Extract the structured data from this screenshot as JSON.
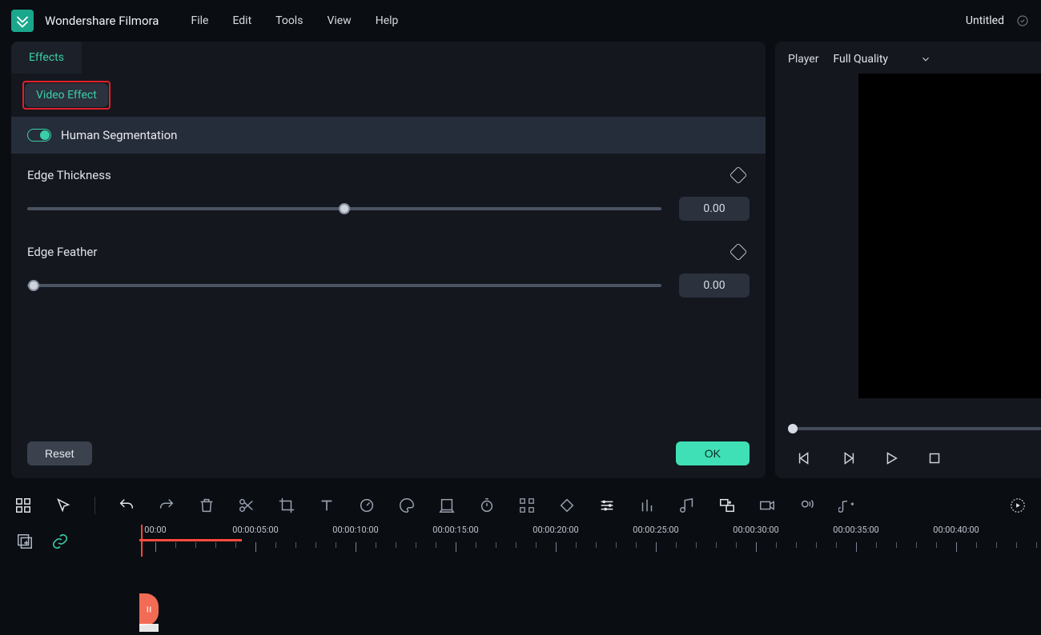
{
  "app_name": "Wondershare Filmora",
  "menu": [
    "File",
    "Edit",
    "Tools",
    "View",
    "Help"
  ],
  "doc_title": "Untitled",
  "tabs": {
    "effects": "Effects"
  },
  "subtab": "Video Effect",
  "segmentation": {
    "label": "Human Segmentation"
  },
  "sliders": {
    "edge_thickness": {
      "label": "Edge Thickness",
      "value": "0.00",
      "pos": 50
    },
    "edge_feather": {
      "label": "Edge Feather",
      "value": "0.00",
      "pos": 0
    }
  },
  "buttons": {
    "reset": "Reset",
    "ok": "OK"
  },
  "player": {
    "label": "Player",
    "quality": "Full Quality"
  },
  "timeline": {
    "labels": [
      "00:00",
      "00:00:05:00",
      "00:00:10:00",
      "00:00:15:00",
      "00:00:20:00",
      "00:00:25:00",
      "00:00:30:00",
      "00:00:35:00",
      "00:00:40:00",
      "00:00"
    ]
  }
}
